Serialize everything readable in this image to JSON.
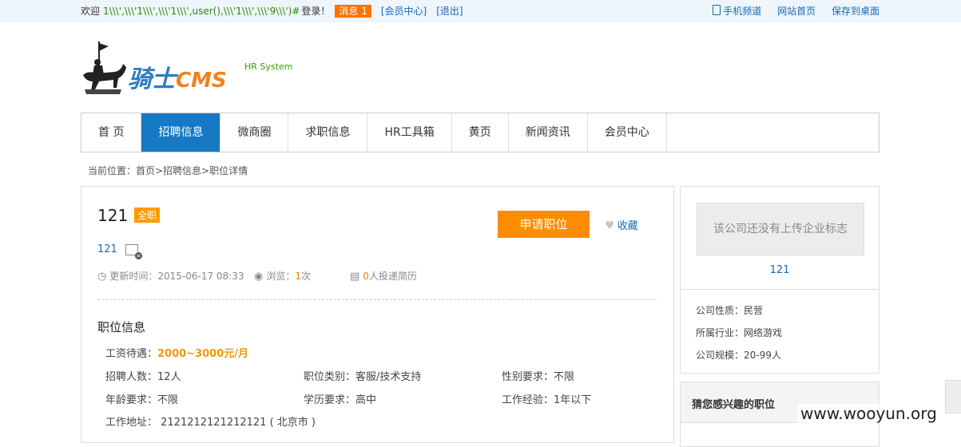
{
  "topbar": {
    "welcome": "欢迎",
    "username": "1\\\\\\',\\\\\\'1\\\\\\',\\\\\\'1\\\\\\',user(),\\\\\\'1\\\\\\',\\\\\\'9\\\\\\')#",
    "login_text": "登录！",
    "message_badge": "消息 1",
    "member_center": "[会员中心]",
    "logout": "[退出]",
    "mobile": "手机频道",
    "home": "网站首页",
    "desktop": "保存到桌面"
  },
  "logo": {
    "brand_cn": "骑士",
    "brand_en": "CMS",
    "subtitle": "HR System"
  },
  "nav": {
    "items": [
      "首 页",
      "招聘信息",
      "微商圈",
      "求职信息",
      "HR工具箱",
      "黄页",
      "新闻资讯",
      "会员中心"
    ]
  },
  "breadcrumb": "当前位置：首页>招聘信息>职位详情",
  "job": {
    "title": "121",
    "type_tag": "全职",
    "apply_label": "申请职位",
    "favorite_label": "收藏",
    "company": "121",
    "updated": "更新时间：2015-06-17 08:33",
    "views_prefix": "浏览：",
    "views": "1",
    "views_suffix": "次",
    "resumes": "0",
    "resumes_suffix": "人投递简历",
    "section_title": "职位信息",
    "salary_label": "工资待遇：",
    "salary_value": "2000~3000元/月",
    "headcount": "招聘人数：12人",
    "category": "职位类别：客服/技术支持",
    "gender": "性别要求：不限",
    "age": "年龄要求：不限",
    "education": "学历要求：高中",
    "experience": "工作经验：1年以下",
    "address": "工作地址： 2121212121212121 ( 北京市 )"
  },
  "sidebar": {
    "no_logo": "该公司还没有上传企业标志",
    "company_name": "121",
    "nature": "公司性质：民营",
    "industry": "所属行业：网络游戏",
    "scale": "公司规模：20-99人",
    "interest_title": "猜您感兴趣的职位"
  },
  "watermark": "www.wooyun.org",
  "colors": {
    "primary_blue": "#1579c4",
    "accent_orange": "#ff8c00",
    "link_blue": "#1769b6"
  }
}
